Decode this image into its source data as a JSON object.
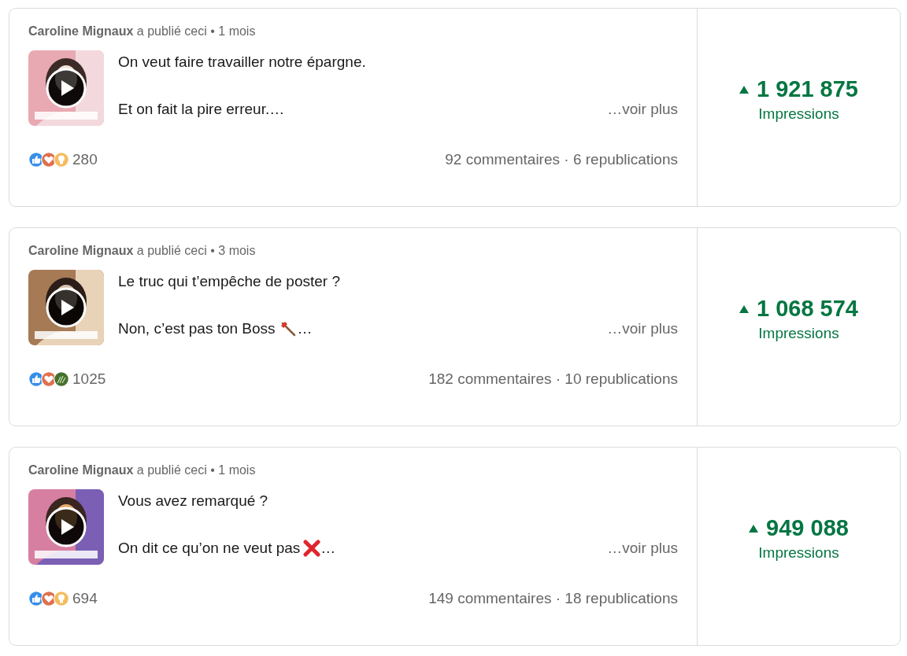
{
  "posts": [
    {
      "author": "Caroline Mignaux",
      "action": "a publié ceci",
      "separator": "•",
      "age": "1 mois",
      "thumbnail": {
        "kind": "picture"
      },
      "lines": [
        [
          {
            "kind": "text",
            "text": "On veut faire travailler notre épargne."
          }
        ],
        [
          {
            "kind": "text",
            "text": "Et on fait la pire erreur.…"
          }
        ]
      ],
      "more": "…voir plus",
      "reactions": [
        {
          "kind": "like"
        },
        {
          "kind": "love"
        },
        {
          "kind": "insightful"
        }
      ],
      "reaction_count": "280",
      "comments": "92 commentaires",
      "dot": "·",
      "reposts": "6 republications",
      "impressions": "1 921 875",
      "impressions_label": "Impressions"
    },
    {
      "author": "Caroline Mignaux",
      "action": "a publié ceci",
      "separator": "•",
      "age": "3 mois",
      "thumbnail": {
        "kind": "picture"
      },
      "lines": [
        [
          {
            "kind": "text",
            "text": "Le truc qui t’empêche de poster ?"
          }
        ],
        [
          {
            "kind": "text",
            "text": "Non, c’est pas ton Boss"
          },
          {
            "kind": "axe"
          },
          {
            "kind": "text",
            "text": "…"
          }
        ]
      ],
      "more": "…voir plus",
      "reactions": [
        {
          "kind": "like"
        },
        {
          "kind": "love"
        },
        {
          "kind": "support"
        }
      ],
      "reaction_count": "1025",
      "comments": "182 commentaires",
      "dot": "·",
      "reposts": "10 republications",
      "impressions": "1 068 574",
      "impressions_label": "Impressions"
    },
    {
      "author": "Caroline Mignaux",
      "action": "a publié ceci",
      "separator": "•",
      "age": "1 mois",
      "thumbnail": {
        "kind": "picture"
      },
      "lines": [
        [
          {
            "kind": "text",
            "text": "Vous avez remarqué ?"
          }
        ],
        [
          {
            "kind": "text",
            "text": "On dit ce qu’on ne veut pas"
          },
          {
            "kind": "cross"
          },
          {
            "kind": "text",
            "text": "…"
          }
        ]
      ],
      "more": "…voir plus",
      "reactions": [
        {
          "kind": "like"
        },
        {
          "kind": "love"
        },
        {
          "kind": "insightful"
        }
      ],
      "reaction_count": "694",
      "comments": "149 commentaires",
      "dot": "·",
      "reposts": "18 republications",
      "impressions": "949 088",
      "impressions_label": "Impressions"
    }
  ]
}
